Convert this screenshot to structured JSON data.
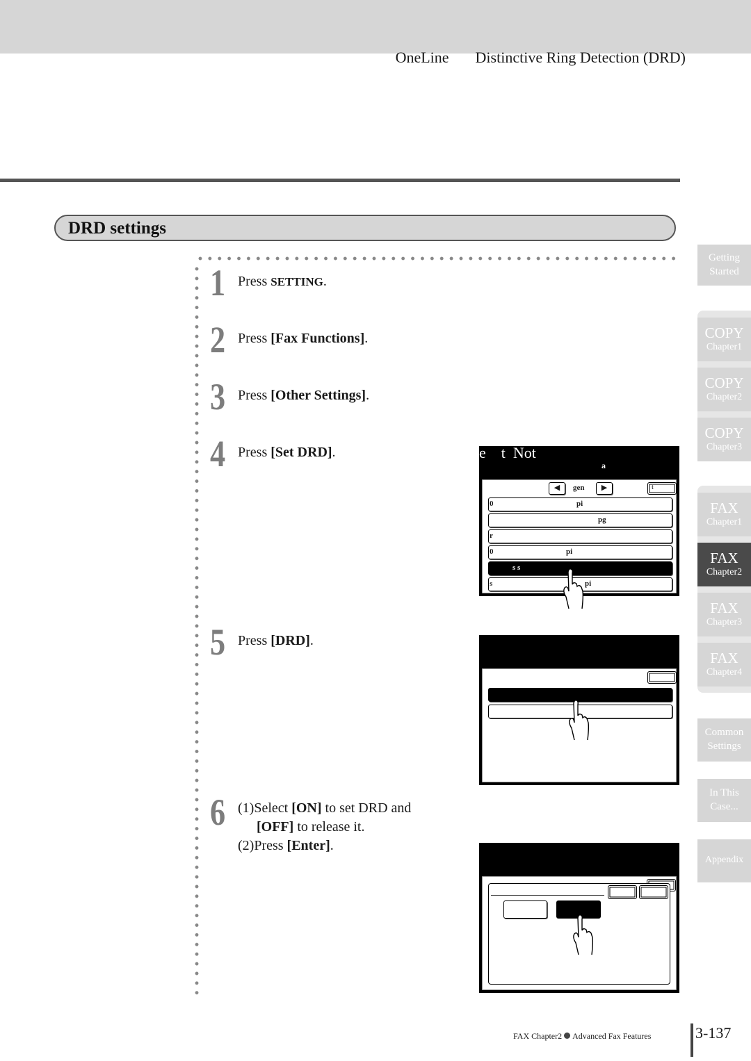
{
  "header": {
    "product": "OneLine",
    "topic": "Distinctive Ring Detection (DRD)"
  },
  "section": {
    "title": "DRD settings"
  },
  "steps": [
    {
      "number": "1",
      "prefix": "Press ",
      "key": "SETTING",
      "suffix": "."
    },
    {
      "number": "2",
      "prefix": "Press ",
      "key": "[Fax Functions]",
      "suffix": "."
    },
    {
      "number": "3",
      "prefix": "Press ",
      "key": "[Other Settings]",
      "suffix": "."
    },
    {
      "number": "4",
      "prefix": "Press ",
      "key": "[Set DRD]",
      "suffix": "."
    },
    {
      "number": "5",
      "prefix": "Press ",
      "key": "[DRD]",
      "suffix": "."
    },
    {
      "number": "6",
      "line1_prefix": "(1)Select ",
      "line1_key": "[ON]",
      "line1_suffix": " to set DRD and",
      "line2_key": "[OFF]",
      "line2_suffix": " to release it.",
      "line3_prefix": "(2)Press ",
      "line3_key": "[Enter]",
      "line3_suffix": "."
    }
  ],
  "screens": {
    "screen1": {
      "title": "e    t  Not",
      "subtitle": "a",
      "nav_prev_icon": "◀",
      "nav_label": "gen",
      "nav_next_icon": "▶",
      "corner_button": "t",
      "rows": [
        {
          "left": "0",
          "center": "pi",
          "selected": false
        },
        {
          "left": "",
          "center": "pg",
          "selected": false
        },
        {
          "left": "r",
          "center": "",
          "selected": false
        },
        {
          "left": "0",
          "center": "pi",
          "selected": false
        },
        {
          "left": "s  s",
          "center": "",
          "selected": true
        },
        {
          "left": "s",
          "center": "pi",
          "selected": false
        }
      ]
    },
    "screen2": {
      "rows_selected": [
        true,
        false
      ]
    },
    "screen3": {
      "on_selected": false,
      "off_selected": true
    }
  },
  "side_tabs": [
    {
      "main": "Getting",
      "sub": "Started",
      "active": false
    },
    {
      "main": "COPY",
      "sub": "Chapter1",
      "active": false
    },
    {
      "main": "COPY",
      "sub": "Chapter2",
      "active": false
    },
    {
      "main": "COPY",
      "sub": "Chapter3",
      "active": false
    },
    {
      "main": "FAX",
      "sub": "Chapter1",
      "active": false
    },
    {
      "main": "FAX",
      "sub": "Chapter2",
      "active": true
    },
    {
      "main": "FAX",
      "sub": "Chapter3",
      "active": false
    },
    {
      "main": "FAX",
      "sub": "Chapter4",
      "active": false
    },
    {
      "main": "Common",
      "sub": "Settings",
      "active": false
    },
    {
      "main": "In This",
      "sub": "Case...",
      "active": false
    },
    {
      "main": "Appendix",
      "sub": "",
      "active": false
    }
  ],
  "footer": {
    "chapter": "FAX Chapter2",
    "section": "Advanced Fax Features",
    "page": "3-137"
  }
}
